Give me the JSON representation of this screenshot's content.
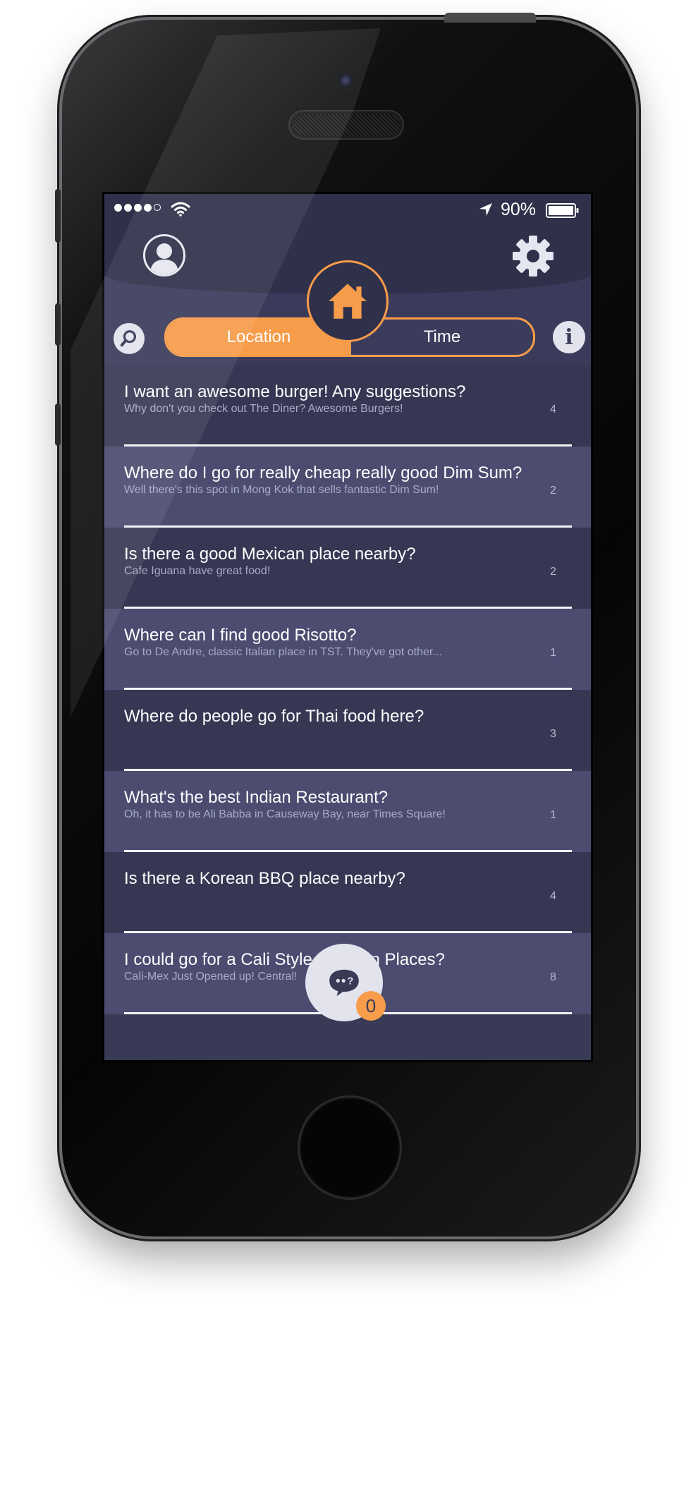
{
  "status_bar": {
    "battery_percent": "90%",
    "signal_bars_filled": 4,
    "signal_bars_total": 5,
    "icons": [
      "wifi-icon",
      "location-arrow-icon",
      "battery-icon"
    ]
  },
  "header": {
    "profile_icon": "profile-icon",
    "settings_icon": "gear-icon",
    "home_icon": "home-icon",
    "search_icon": "search-icon",
    "info_icon": "info-icon",
    "info_glyph": "i",
    "toggle": {
      "left_label": "Location",
      "right_label": "Time",
      "selected": "Location"
    }
  },
  "colors": {
    "accent": "#f79c4a",
    "background": "#393a55",
    "row_dark": "#363753",
    "row_light": "#4b4c70"
  },
  "questions": [
    {
      "question": "I want an awesome burger! Any suggestions?",
      "answer": "Why don't you check out The Diner? Awesome Burgers!",
      "count": "4"
    },
    {
      "question": "Where do I go for really cheap really good Dim Sum?",
      "answer": "Well there's this spot in Mong Kok that sells fantastic Dim Sum!",
      "count": "2"
    },
    {
      "question": "Is there a good Mexican place nearby?",
      "answer": "Cafe Iguana have great food!",
      "count": "2"
    },
    {
      "question": "Where can I find good Risotto?",
      "answer": "Go to De Andre, classic Italian place in TST. They've got other...",
      "count": "1"
    },
    {
      "question": "Where do people go for Thai food here?",
      "answer": "",
      "count": "3"
    },
    {
      "question": "What's the best Indian Restaurant?",
      "answer": "Oh, it has to be Ali Babba in Causeway Bay, near Times Square!",
      "count": "1"
    },
    {
      "question": "Is there a Korean BBQ place nearby?",
      "answer": "",
      "count": "4"
    },
    {
      "question": "I could go for a Cali Style Mexican Places?",
      "answer": "Cali-Mex Just Opened up! Central!",
      "count": "8"
    }
  ],
  "chat": {
    "icon": "chat-bubble-icon",
    "badge_count": "0"
  }
}
